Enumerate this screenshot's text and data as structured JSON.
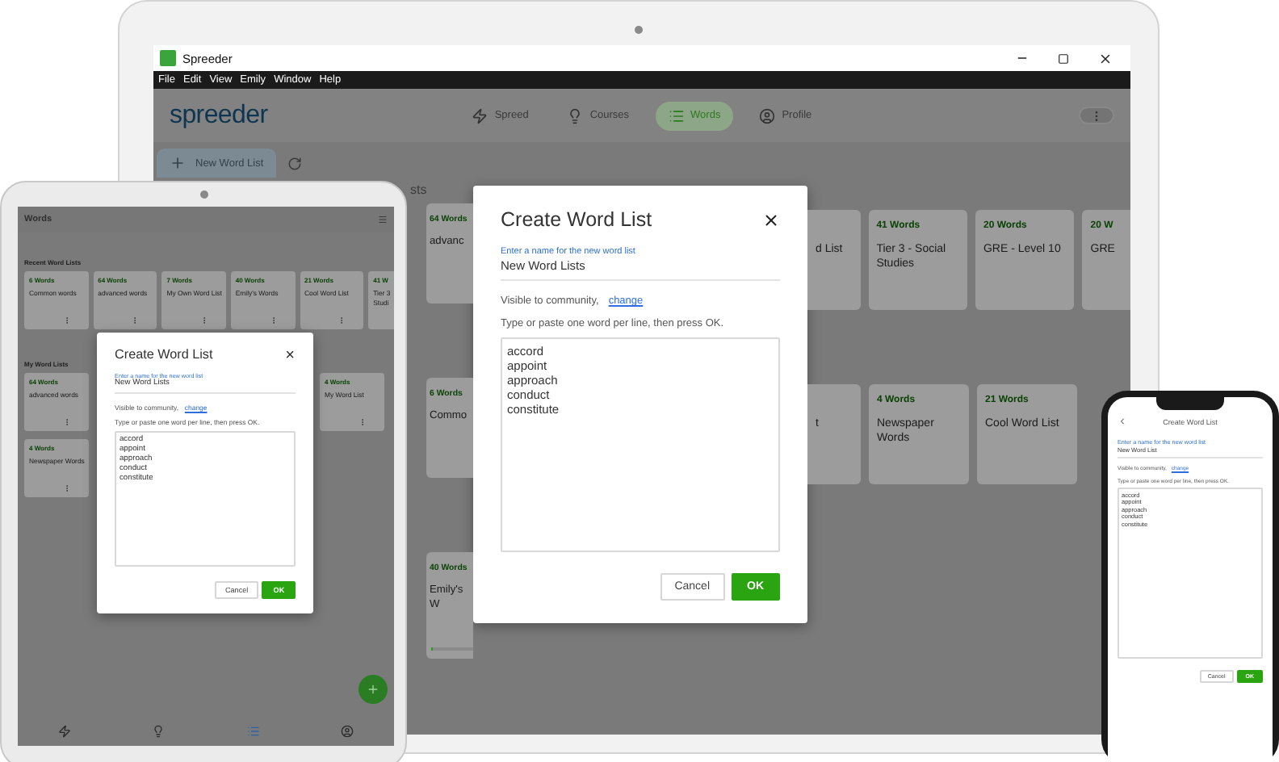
{
  "laptop": {
    "window": {
      "title": "Spreeder"
    },
    "menu": [
      "File",
      "Edit",
      "View",
      "Emily",
      "Window",
      "Help"
    ],
    "logo": "spreeder",
    "nav": [
      {
        "kind": "spreed",
        "label": "Spreed",
        "selected": false
      },
      {
        "kind": "courses",
        "label": "Courses",
        "selected": false
      },
      {
        "kind": "words",
        "label": "Words",
        "selected": true
      },
      {
        "kind": "profile",
        "label": "Profile",
        "selected": false
      }
    ],
    "new_list_button": "New Word List",
    "section_heading": "sts",
    "left_cards": [
      {
        "count": "64 Words",
        "title": "advanc"
      },
      {
        "count": "6 Words",
        "title": "Commo"
      },
      {
        "count": "40 Words",
        "title": "Emily's W",
        "level": 0.05
      }
    ],
    "dialog": {
      "title": "Create Word List",
      "name_label": "Enter a name for the new word list",
      "name_value": "New Word Lists",
      "visibility": "Visible to community,",
      "visibility_link": "change",
      "instruction": "Type or paste one word per line, then press OK.",
      "words": [
        "accord",
        "appoint",
        "approach",
        "conduct",
        "constitute"
      ],
      "buttons": [
        {
          "kind": "cancel",
          "label": "Cancel"
        },
        {
          "kind": "ok",
          "label": "OK"
        }
      ]
    },
    "right_rows": [
      [
        {
          "kind": "cut_left",
          "title": "d List"
        },
        {
          "kind": "full",
          "count": "41 Words",
          "title": "Tier 3 - Social Studies"
        },
        {
          "kind": "full",
          "count": "20 Words",
          "title": "GRE - Level 10"
        },
        {
          "kind": "cut_right",
          "count": "20 W",
          "title": "GRE"
        }
      ],
      [
        {
          "kind": "cut_left",
          "title": "t"
        },
        {
          "kind": "full",
          "count": "4 Words",
          "title": "Newspaper Words"
        },
        {
          "kind": "full",
          "count": "21 Words",
          "title": "Cool Word List"
        }
      ]
    ]
  },
  "tablet": {
    "header": "Words",
    "recent_heading": "Recent Word Lists",
    "recent_cards": [
      {
        "kind": "full",
        "count": "6 Words",
        "title": "Common words"
      },
      {
        "kind": "full",
        "count": "64 Words",
        "title": "advanced words"
      },
      {
        "kind": "full",
        "count": "7 Words",
        "title": "My Own Word List"
      },
      {
        "kind": "full",
        "count": "40 Words",
        "title": "Emily's Words"
      },
      {
        "kind": "full",
        "count": "21 Words",
        "title": "Cool Word List"
      },
      {
        "kind": "cut_right",
        "count": "41 W",
        "title": "Tier 3 Studi"
      }
    ],
    "my_heading": "My Word Lists",
    "my_cards_left": [
      {
        "count": "64 Words",
        "title": "advanced words"
      },
      {
        "count": "4 Words",
        "title": "Newspaper Words"
      }
    ],
    "my_cards_right": [
      {
        "count": "4 Words",
        "title": "My Word List"
      }
    ],
    "dialog": {
      "title": "Create Word List",
      "name_label": "Enter a name for the new word list",
      "name_value": "New Word Lists",
      "visibility": "Visible to community,",
      "visibility_link": "change",
      "instruction": "Type or paste one word per line, then press OK.",
      "words": [
        "accord",
        "appoint",
        "approach",
        "conduct",
        "constitute"
      ],
      "buttons": [
        {
          "kind": "cancel",
          "label": "Cancel"
        },
        {
          "kind": "ok",
          "label": "OK"
        }
      ]
    },
    "nav": [
      {
        "kind": "spreed",
        "selected": false
      },
      {
        "kind": "courses",
        "selected": false
      },
      {
        "kind": "words",
        "selected": true
      },
      {
        "kind": "profile",
        "selected": false
      }
    ]
  },
  "phone": {
    "dialog": {
      "title": "Create Word List",
      "name_label": "Enter a name for the new word list",
      "name_value": "New Word List",
      "visibility": "Visible to community,",
      "visibility_link": "change",
      "instruction": "Type or paste one word per line, then press OK.",
      "words": [
        "accord",
        "appoint",
        "approach",
        "conduct",
        "constitute"
      ],
      "buttons": [
        {
          "kind": "cancel",
          "label": "Cancel"
        },
        {
          "kind": "ok",
          "label": "OK"
        }
      ]
    }
  }
}
